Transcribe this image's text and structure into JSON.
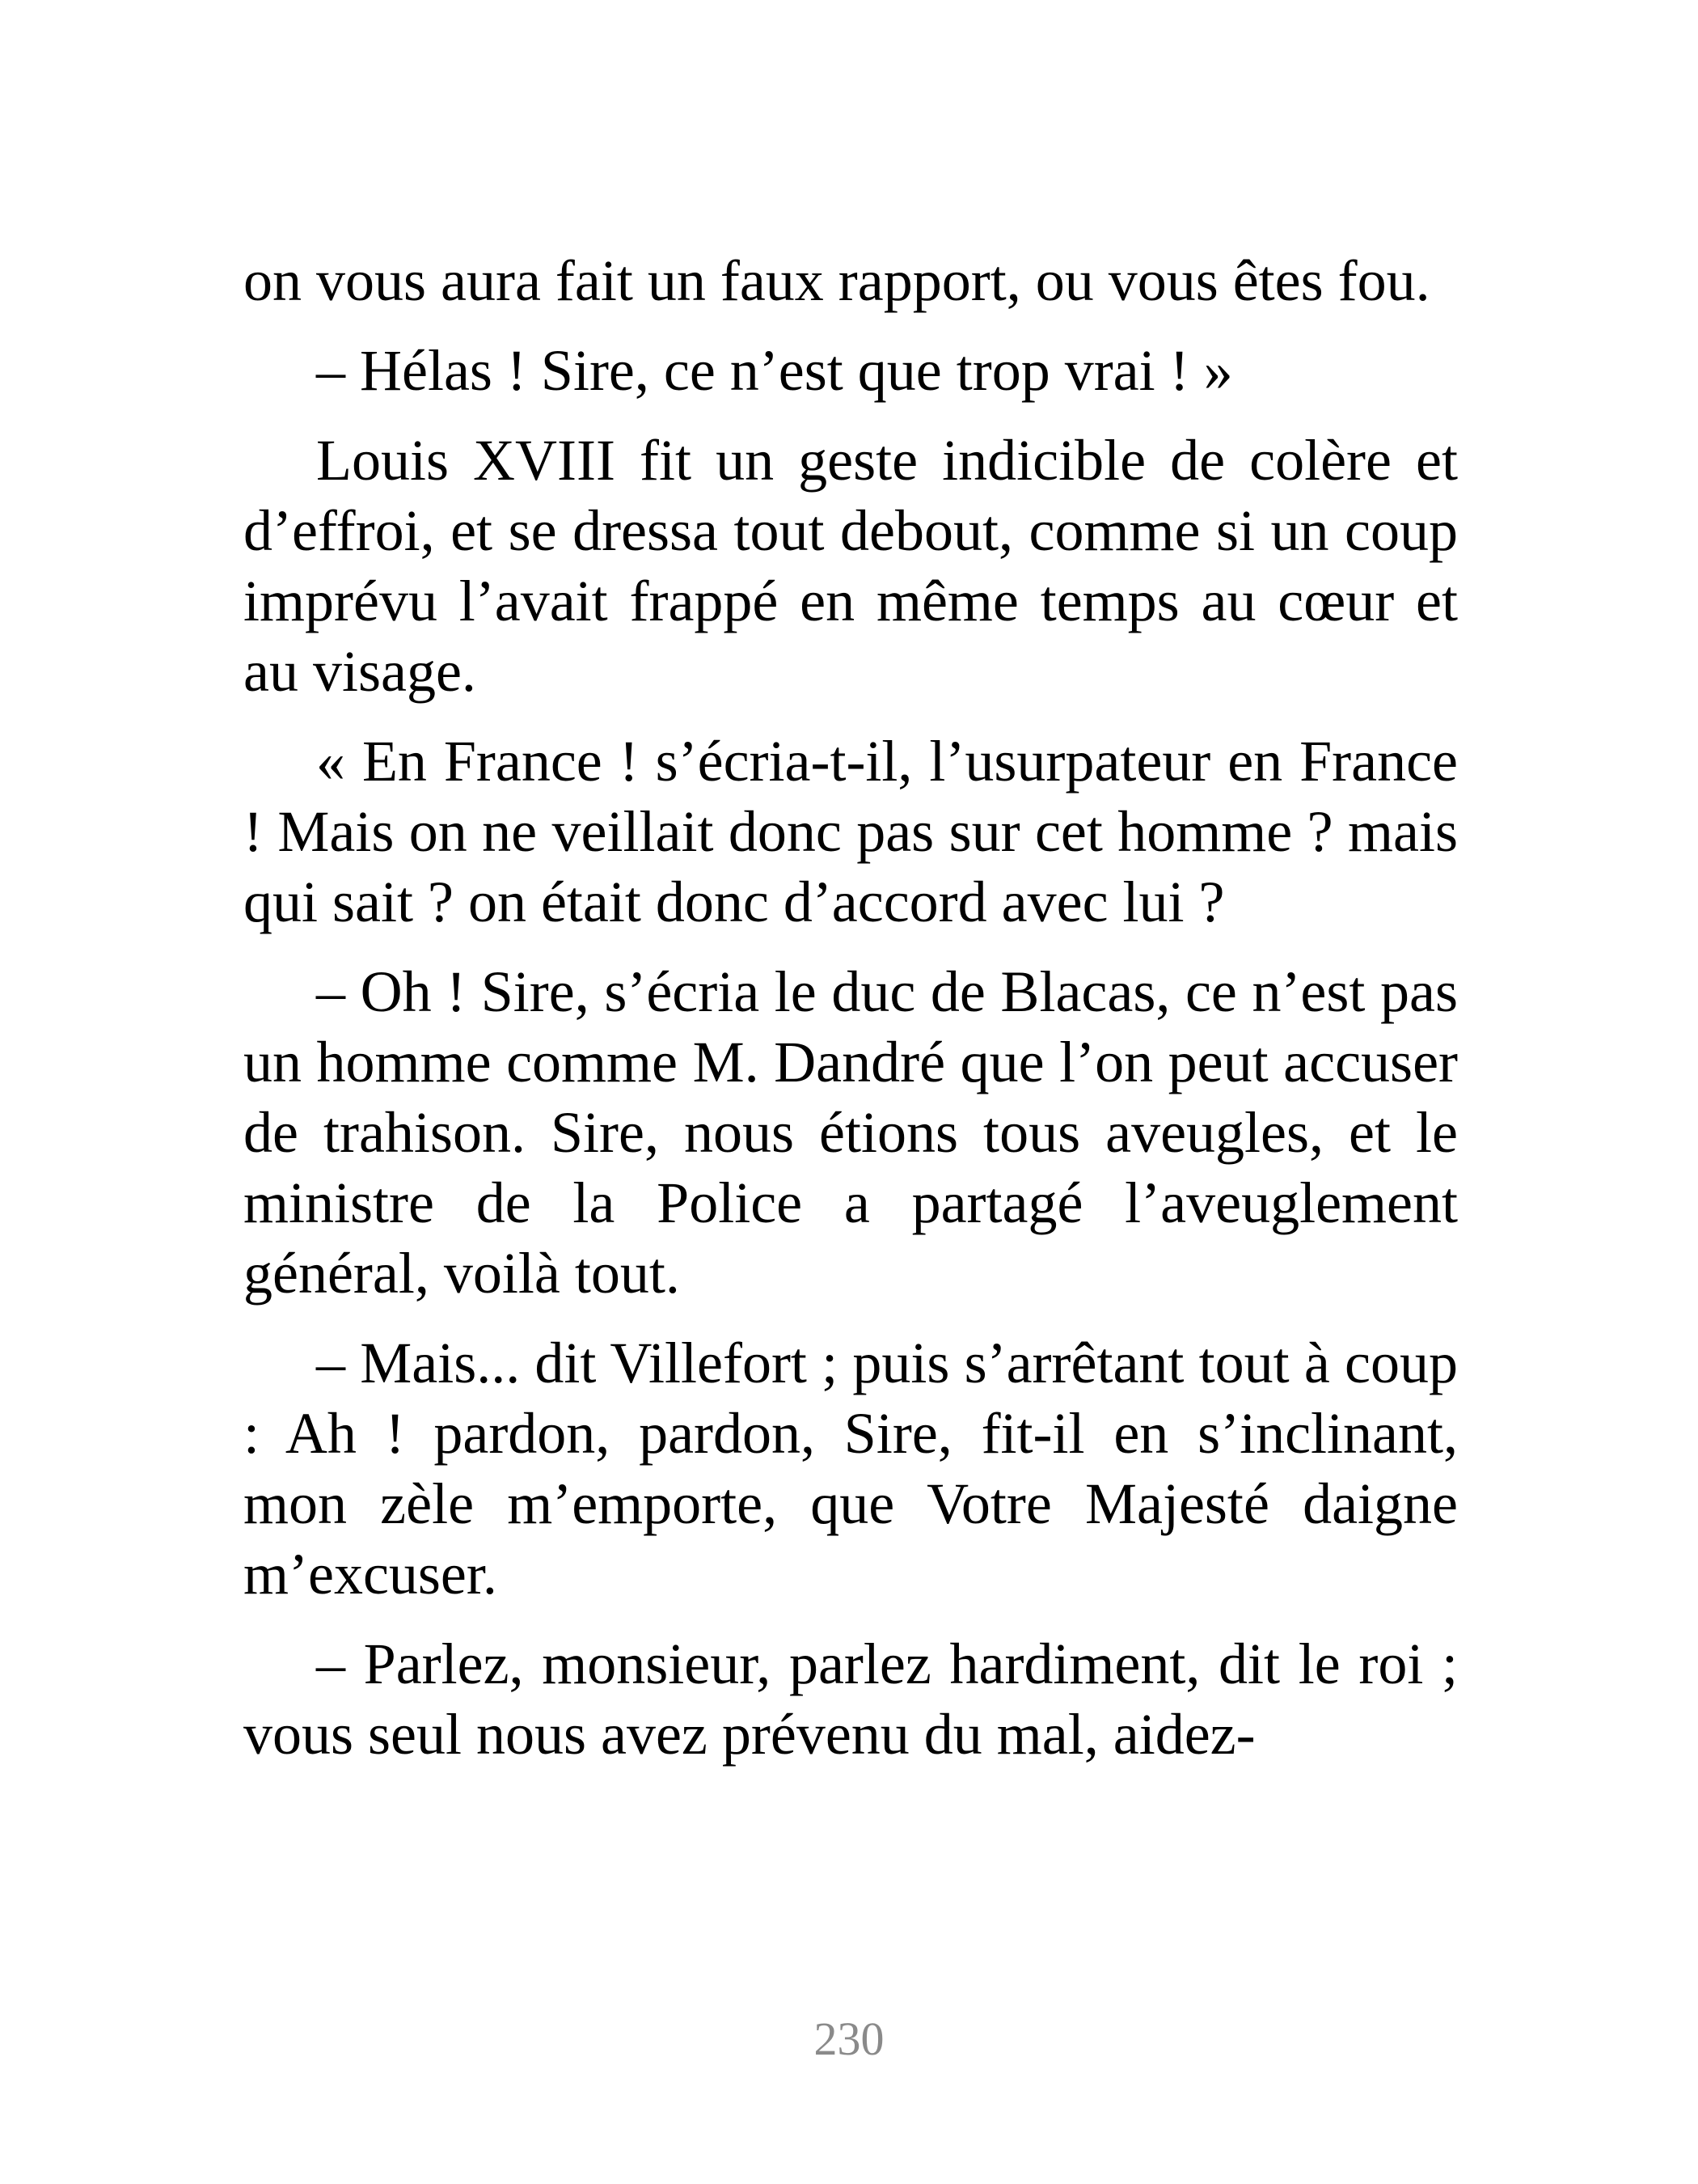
{
  "document": {
    "paragraphs": [
      {
        "indent": false,
        "text": "on vous aura fait un faux rapport, ou vous êtes fou."
      },
      {
        "indent": true,
        "text": "– Hélas ! Sire, ce n’est que trop vrai ! »"
      },
      {
        "indent": true,
        "text": "Louis XVIII fit un geste indicible de colère et d’effroi, et se dressa tout debout, comme si un coup imprévu l’avait frappé en même temps au cœur et au visage."
      },
      {
        "indent": true,
        "text": "« En France ! s’écria-t-il, l’usurpateur en France ! Mais on ne veillait donc pas sur cet homme ? mais qui sait ? on était donc d’accord avec lui ?"
      },
      {
        "indent": true,
        "text": "– Oh ! Sire, s’écria le duc de Blacas, ce n’est pas un homme comme M. Dandré que l’on peut accuser de trahison. Sire, nous étions tous aveugles, et le ministre de la Police a partagé l’aveuglement général, voilà tout."
      },
      {
        "indent": true,
        "text": "– Mais... dit Villefort ; puis s’arrêtant tout à coup : Ah ! pardon, pardon, Sire, fit-il en s’inclinant, mon zèle m’emporte, que Votre Majesté daigne m’excuser."
      },
      {
        "indent": true,
        "text": "– Parlez, monsieur, parlez hardiment, dit le roi ; vous seul nous avez prévenu du mal, aidez-"
      }
    ],
    "page_number": "230"
  }
}
